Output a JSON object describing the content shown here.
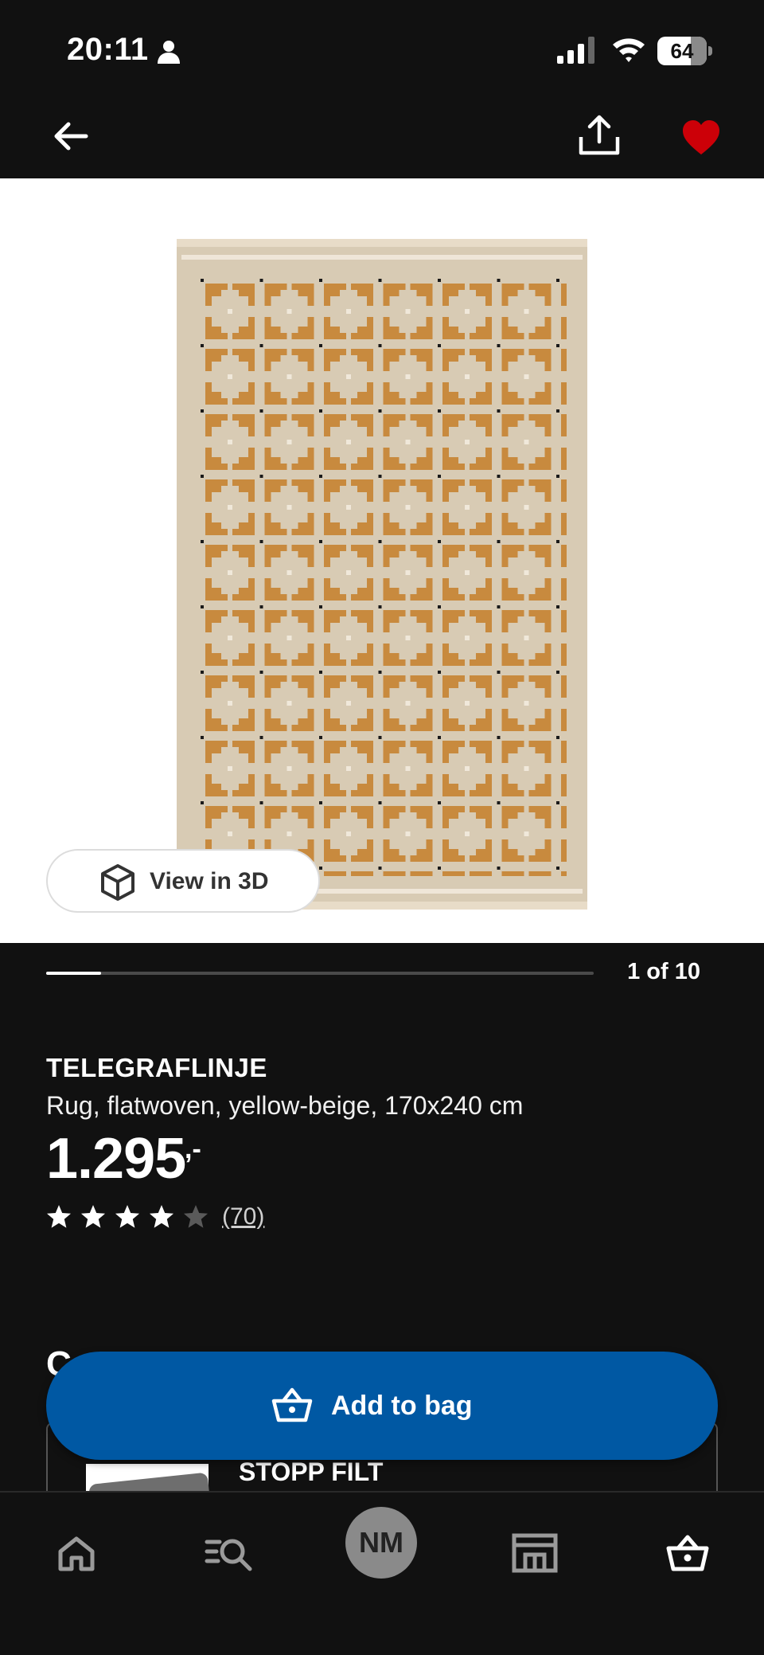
{
  "status_bar": {
    "time": "20:11",
    "battery": "64"
  },
  "product": {
    "name": "TELEGRAFLINJE",
    "description": "Rug, flatwoven, yellow-beige, 170x240 cm",
    "price": "1.295",
    "price_suffix": ",-",
    "rating": 4,
    "rating_max": 5,
    "review_count": "(70)"
  },
  "gallery": {
    "view_3d_label": "View in 3D",
    "page_indicator": "1 of 10",
    "current": 1,
    "total": 10
  },
  "related": {
    "section_letter": "C",
    "item_title": "STOPP FILT"
  },
  "actions": {
    "add_to_bag": "Add to bag"
  },
  "nav": {
    "profile_initials": "NM"
  },
  "colors": {
    "background": "#111111",
    "primary_button": "#0058a3",
    "favorite": "#cc0008",
    "rug_base": "#d8cbb4",
    "rug_pattern": "#c88a3e"
  },
  "icons": [
    "back-icon",
    "share-icon",
    "heart-icon",
    "cube-icon",
    "basket-icon",
    "home-icon",
    "search-list-icon",
    "store-icon"
  ]
}
